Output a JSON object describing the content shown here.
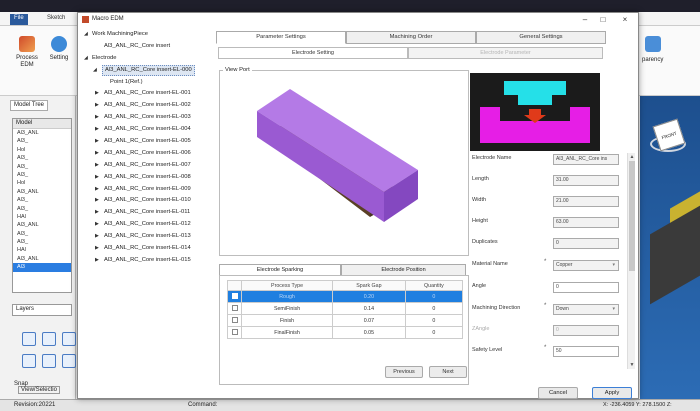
{
  "app": {
    "ribbon_tabs": [
      "File",
      "Sketch"
    ],
    "ribbon_buttons": [
      "Process EDM",
      "Setting"
    ],
    "ribbon_right_label": "parency",
    "left_tabs": [
      "Model Tree"
    ],
    "model_header": "Model",
    "model_tree": [
      "Al3_ANL",
      "Al3_",
      "Hol",
      "Al3_",
      "Al3_",
      "Al3_",
      "Hol",
      "Al3_ANL",
      "Al3_",
      "Al3_",
      "HAl",
      "Al3_ANL",
      "Al3_",
      "Al3_",
      "HAl",
      "Al3_ANL",
      "Al3"
    ],
    "layers_label": "Layers",
    "snap_label": "Snap",
    "view_selection_label": "View/Selectio",
    "status_revision": "Revision:20221",
    "status_command": "Command:",
    "status_coords": "X: -236.4059 Y: 278.1500 Z:",
    "cube_label": "FRONT"
  },
  "dialog": {
    "title": "Macro EDM",
    "tree": {
      "work_piece": "Work MachiningPiece",
      "work_item": "Al3_ANL_RC_Core insert",
      "electrode": "Electrode",
      "selected": "Al3_ANL_RC_Core insert-EL-000",
      "point": "Point 1(Ref.)",
      "items": [
        "Al3_ANL_RC_Core insert-EL-001",
        "Al3_ANL_RC_Core insert-EL-002",
        "Al3_ANL_RC_Core insert-EL-003",
        "Al3_ANL_RC_Core insert-EL-004",
        "Al3_ANL_RC_Core insert-EL-005",
        "Al3_ANL_RC_Core insert-EL-006",
        "Al3_ANL_RC_Core insert-EL-007",
        "Al3_ANL_RC_Core insert-EL-008",
        "Al3_ANL_RC_Core insert-EL-009",
        "Al3_ANL_RC_Core insert-EL-010",
        "Al3_ANL_RC_Core insert-EL-011",
        "Al3_ANL_RC_Core insert-EL-012",
        "Al3_ANL_RC_Core insert-EL-013",
        "Al3_ANL_RC_Core insert-EL-014",
        "Al3_ANL_RC_Core insert-EL-015"
      ]
    },
    "tabs": [
      "Parameter Settings",
      "Machining Order",
      "General Settings"
    ],
    "subtabs": [
      "Electrode Setting",
      "Electrode Parameter"
    ],
    "viewport_label": "View Port",
    "spark_tabs": [
      "Electrode Sparking",
      "Electrode Position"
    ],
    "spark_columns": [
      "Process Type",
      "Spark Gap",
      "Quantity"
    ],
    "spark_rows": [
      {
        "type": "Rough",
        "gap": "0.20",
        "qty": "0"
      },
      {
        "type": "SemiFinish",
        "gap": "0.14",
        "qty": "0"
      },
      {
        "type": "Finish",
        "gap": "0.07",
        "qty": "0"
      },
      {
        "type": "FinalFinish",
        "gap": "0.05",
        "qty": "0"
      }
    ],
    "previous_label": "Previous",
    "next_label": "Next",
    "properties": {
      "electrode_name_label": "Electrode Name",
      "electrode_name": "Al3_ANL_RC_Core ins",
      "length_label": "Length",
      "length": "31.00",
      "width_label": "Width",
      "width": "21.00",
      "height_label": "Height",
      "height": "63.00",
      "duplicates_label": "Duplicates",
      "duplicates": "0",
      "material_label": "Material Name",
      "material": "Copper",
      "angle_label": "Angle",
      "angle": "0",
      "direction_label": "Machining Direction",
      "direction": "Down",
      "zangle_label": "ZAngle",
      "zangle": "0",
      "safety_label": "Safety Level",
      "safety": "50"
    },
    "cancel_label": "Cancel",
    "apply_label": "Apply"
  },
  "colors": {
    "accent_blue": "#1f7fe0",
    "preview_magenta": "#e61ee6",
    "preview_cyan": "#25e0e8",
    "preview_arrow": "#e03a1a",
    "electrode_purple": "#a56ad8"
  }
}
